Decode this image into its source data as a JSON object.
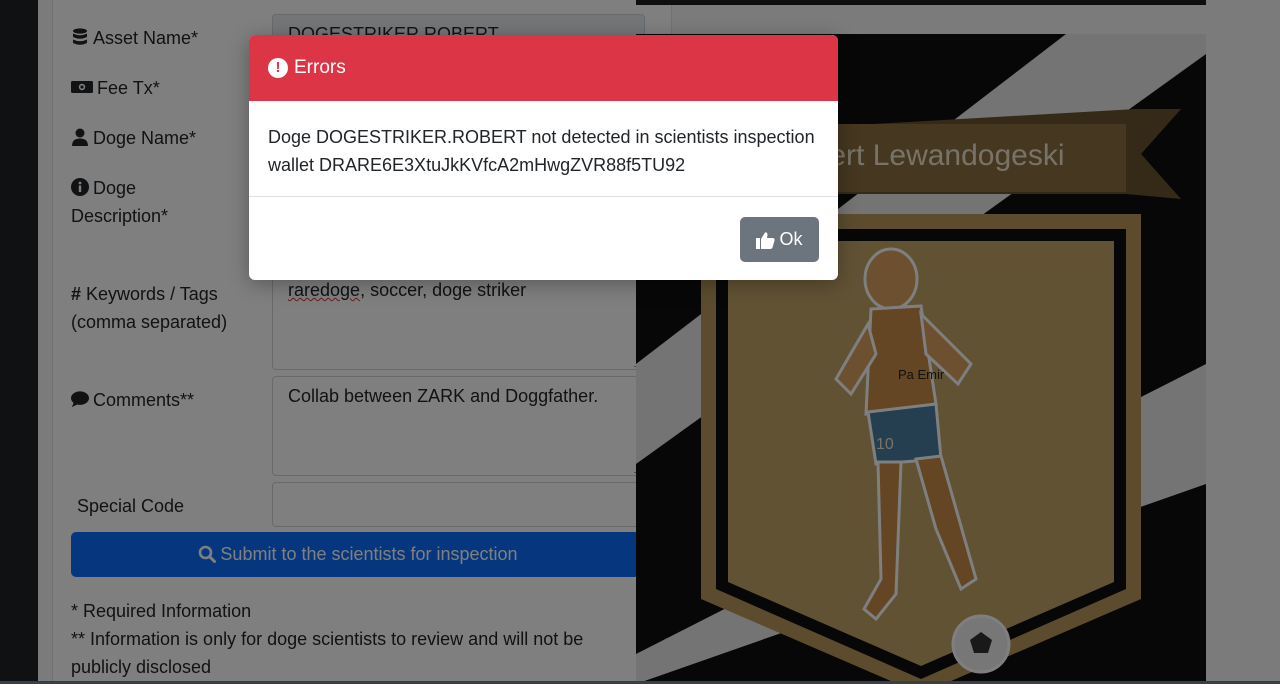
{
  "form": {
    "asset_name_label": "Asset Name*",
    "asset_name_value": "DOGESTRIKER.ROBERT",
    "fee_tx_label": "Fee Tx*",
    "doge_name_label": "Doge Name*",
    "doge_description_label_line1": "Doge",
    "doge_description_label_line2": "Description*",
    "keywords_label_line1": "Keywords / Tags",
    "keywords_label_line2": "(comma separated)",
    "keywords_value_word1": "raredoge",
    "keywords_value_rest": ", soccer, doge striker",
    "comments_label": "Comments**",
    "comments_value": "Collab between ZARK and Doggfather.",
    "special_code_label": "Special Code",
    "special_code_value": "",
    "submit_label": "Submit to the scientists for inspection",
    "note_required": "* Required Information",
    "note_private": "** Information is only for doge scientists to review and will not be publicly disclosed"
  },
  "artwork": {
    "banner_text": "obert Lewandogeski",
    "jersey_text": "Pa Emir",
    "jersey_number": "10"
  },
  "modal": {
    "title": "Errors",
    "message": "Doge DOGESTRIKER.ROBERT not detected in scientists inspection wallet DRARE6E3XtuJkKVfcA2mHwgZVR88f5TU92",
    "ok_label": "Ok"
  },
  "colors": {
    "danger": "#dc3545",
    "primary": "#0d6efd",
    "secondary": "#6c757d"
  }
}
